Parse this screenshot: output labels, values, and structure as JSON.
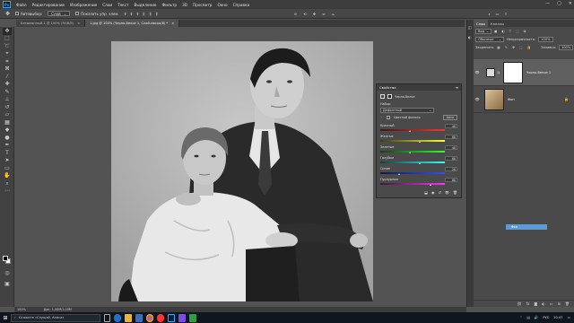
{
  "menubar": {
    "logo": "Ps",
    "items": [
      "Файл",
      "Редактирование",
      "Изображение",
      "Слои",
      "Текст",
      "Выделение",
      "Фильтр",
      "3D",
      "Просмотр",
      "Окно",
      "Справка"
    ],
    "window_controls": [
      "—",
      "▢",
      "✕"
    ]
  },
  "options": {
    "auto_select_label": "Автовыбор:",
    "auto_select_value": "Слой",
    "show_controls_label": "Показать упр. элем."
  },
  "tabs": [
    {
      "label": "Безымянный-1 @ 100% (RGB/8)",
      "active": false
    },
    {
      "label": "1.jpg @ 100% (Черно-белое 1, Слой-маска/8) *",
      "active": true
    }
  ],
  "properties": {
    "title": "Свойства",
    "subtitle": "Черно-белое",
    "preset_label": "Набор:",
    "preset_value": "Дефолтный",
    "tint_label": "Цветной фильтр",
    "auto_label": "Авто",
    "sliders": [
      {
        "label": "Красный",
        "value": "40",
        "pos": 0.46,
        "gradient": "linear-gradient(90deg,#3a1a1a,#ff3030)"
      },
      {
        "label": "Желтые",
        "value": "60",
        "pos": 0.62,
        "gradient": "linear-gradient(90deg,#3a3a1a,#ffff30)"
      },
      {
        "label": "Зеленые",
        "value": "40",
        "pos": 0.46,
        "gradient": "linear-gradient(90deg,#1a3a1a,#30ff30)"
      },
      {
        "label": "Голубые",
        "value": "60",
        "pos": 0.62,
        "gradient": "linear-gradient(90deg,#1a3a3a,#30ffff)"
      },
      {
        "label": "Синие",
        "value": "20",
        "pos": 0.3,
        "gradient": "linear-gradient(90deg,#1a1a3a,#3050ff)"
      },
      {
        "label": "Пурпурные",
        "value": "80",
        "pos": 0.78,
        "gradient": "linear-gradient(90deg,#3a1a3a,#ff30ff)"
      }
    ]
  },
  "layers_panel": {
    "tabs": [
      "Слои",
      "Каналы"
    ],
    "filter_label": "Вид",
    "blend_mode": "Обычные",
    "opacity_label": "Непрозрачность:",
    "opacity_value": "100%",
    "lock_label": "Закрепить:",
    "fill_label": "Заливка:",
    "fill_value": "100%",
    "layers": [
      {
        "name": "Черно-белое 1",
        "selected": true
      },
      {
        "name": "Фон",
        "selected": false
      }
    ],
    "drag_label": "Фон"
  },
  "status": {
    "zoom": "100%",
    "doc_info": "Док: 1,00М/1,00М"
  },
  "taskbar": {
    "search_placeholder": "Скажите «Слушай, Алиса»",
    "lang": "РУС",
    "time": "20:47"
  }
}
